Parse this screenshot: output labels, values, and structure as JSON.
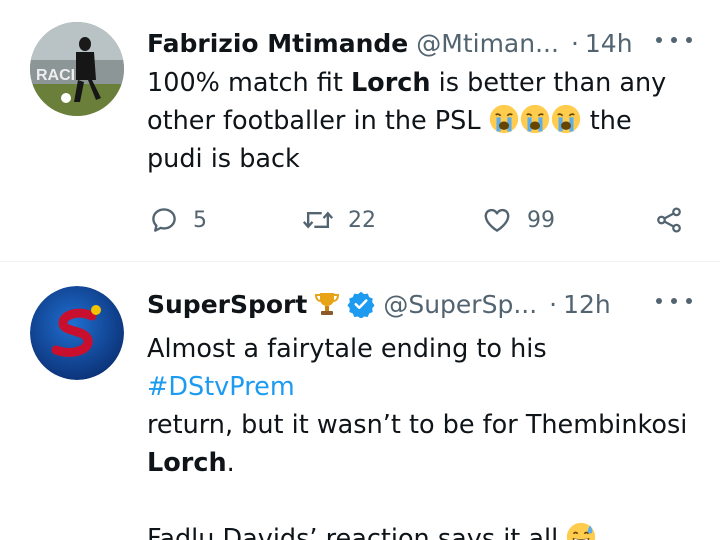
{
  "tweets": [
    {
      "author_name": "Fabrizio Mtimande",
      "handle": "@Mtiman...",
      "separator": "·",
      "time": "14h",
      "text_parts": [
        {
          "t": "100% match fit "
        },
        {
          "t": "Lorch",
          "bold": true
        },
        {
          "t": " is better than any other footballer in the PSL "
        },
        {
          "emoji": "crying-face",
          "count": 3
        },
        {
          "t": " the pudi is back"
        }
      ],
      "text_lines": {
        "l1a": "100% match fit ",
        "l1b": "Lorch",
        "l1c": " is better than any",
        "l2": "other footballer in the PSL ",
        "l2b": " the",
        "l3": "pudi is back"
      },
      "actions": {
        "replies": "5",
        "retweets": "22",
        "likes": "99"
      },
      "avatar_text": "RACI"
    },
    {
      "author_name": "SuperSport",
      "handle": "@SuperSp...",
      "separator": "·",
      "time": "12h",
      "text_lines": {
        "l1": "Almost a fairytale ending to his ",
        "l1tag": "#DStvPrem",
        "l2": "return, but it wasn’t to be for Thembinkosi",
        "l3b": "Lorch",
        "l3c": ".",
        "l5": "Fadlu Davids’ reaction says it all "
      },
      "badges": [
        "trophy-icon",
        "verified-icon"
      ]
    }
  ],
  "colors": {
    "text": "#0f1419",
    "secondary": "#536471",
    "link": "#1d9bf0",
    "divider": "#eff3f4",
    "supersport_red": "#c8102e"
  }
}
